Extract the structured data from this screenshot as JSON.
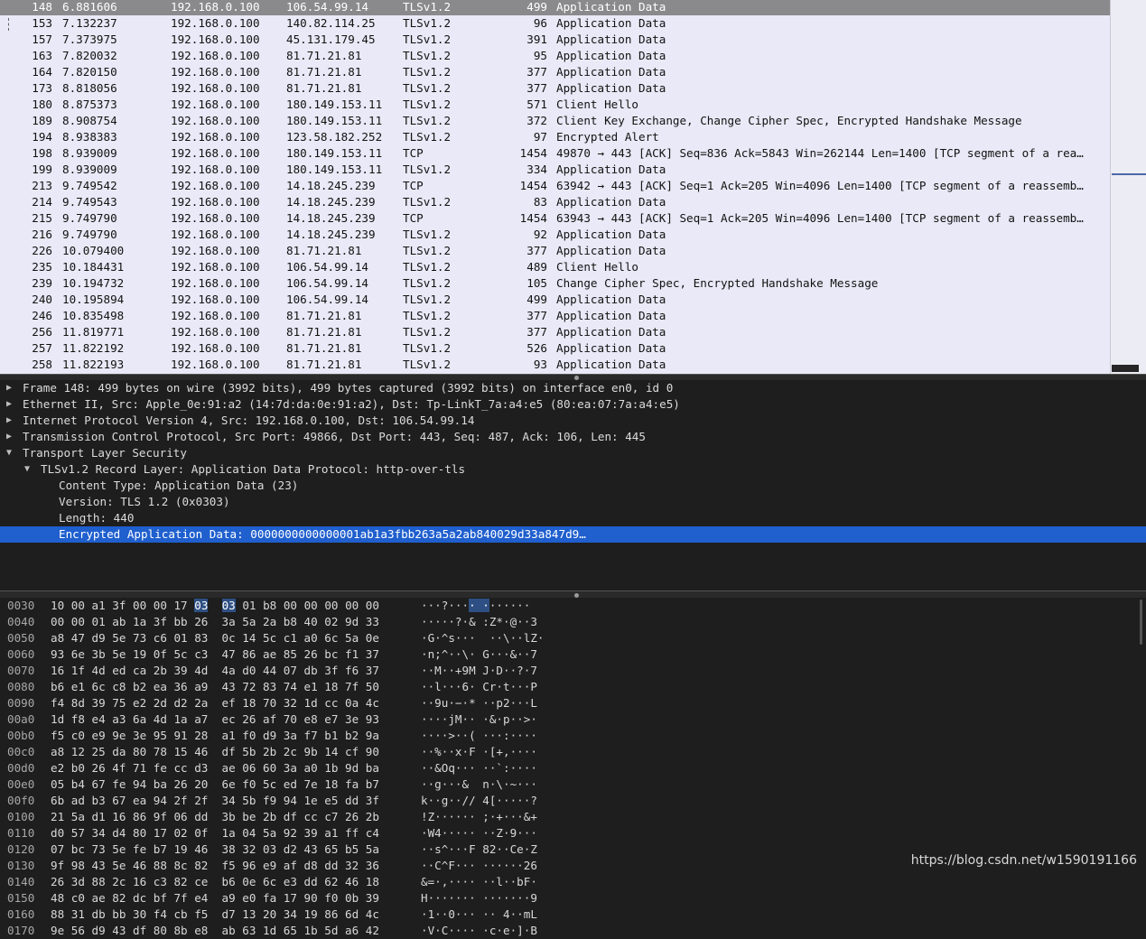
{
  "packet_list": {
    "rows": [
      {
        "no": "148",
        "time": "6.881606",
        "src": "192.168.0.100",
        "dst": "106.54.99.14",
        "proto": "TLSv1.2",
        "len": "499",
        "info": "Application Data",
        "selected": true
      },
      {
        "no": "153",
        "time": "7.132237",
        "src": "192.168.0.100",
        "dst": "140.82.114.25",
        "proto": "TLSv1.2",
        "len": "96",
        "info": "Application Data"
      },
      {
        "no": "157",
        "time": "7.373975",
        "src": "192.168.0.100",
        "dst": "45.131.179.45",
        "proto": "TLSv1.2",
        "len": "391",
        "info": "Application Data"
      },
      {
        "no": "163",
        "time": "7.820032",
        "src": "192.168.0.100",
        "dst": "81.71.21.81",
        "proto": "TLSv1.2",
        "len": "95",
        "info": "Application Data"
      },
      {
        "no": "164",
        "time": "7.820150",
        "src": "192.168.0.100",
        "dst": "81.71.21.81",
        "proto": "TLSv1.2",
        "len": "377",
        "info": "Application Data"
      },
      {
        "no": "173",
        "time": "8.818056",
        "src": "192.168.0.100",
        "dst": "81.71.21.81",
        "proto": "TLSv1.2",
        "len": "377",
        "info": "Application Data"
      },
      {
        "no": "180",
        "time": "8.875373",
        "src": "192.168.0.100",
        "dst": "180.149.153.11",
        "proto": "TLSv1.2",
        "len": "571",
        "info": "Client Hello"
      },
      {
        "no": "189",
        "time": "8.908754",
        "src": "192.168.0.100",
        "dst": "180.149.153.11",
        "proto": "TLSv1.2",
        "len": "372",
        "info": "Client Key Exchange, Change Cipher Spec, Encrypted Handshake Message"
      },
      {
        "no": "194",
        "time": "8.938383",
        "src": "192.168.0.100",
        "dst": "123.58.182.252",
        "proto": "TLSv1.2",
        "len": "97",
        "info": "Encrypted Alert"
      },
      {
        "no": "198",
        "time": "8.939009",
        "src": "192.168.0.100",
        "dst": "180.149.153.11",
        "proto": "TCP",
        "len": "1454",
        "info": "49870 → 443 [ACK] Seq=836 Ack=5843 Win=262144 Len=1400 [TCP segment of a rea…"
      },
      {
        "no": "199",
        "time": "8.939009",
        "src": "192.168.0.100",
        "dst": "180.149.153.11",
        "proto": "TLSv1.2",
        "len": "334",
        "info": "Application Data"
      },
      {
        "no": "213",
        "time": "9.749542",
        "src": "192.168.0.100",
        "dst": "14.18.245.239",
        "proto": "TCP",
        "len": "1454",
        "info": "63942 → 443 [ACK] Seq=1 Ack=205 Win=4096 Len=1400 [TCP segment of a reassemb…"
      },
      {
        "no": "214",
        "time": "9.749543",
        "src": "192.168.0.100",
        "dst": "14.18.245.239",
        "proto": "TLSv1.2",
        "len": "83",
        "info": "Application Data"
      },
      {
        "no": "215",
        "time": "9.749790",
        "src": "192.168.0.100",
        "dst": "14.18.245.239",
        "proto": "TCP",
        "len": "1454",
        "info": "63943 → 443 [ACK] Seq=1 Ack=205 Win=4096 Len=1400 [TCP segment of a reassemb…"
      },
      {
        "no": "216",
        "time": "9.749790",
        "src": "192.168.0.100",
        "dst": "14.18.245.239",
        "proto": "TLSv1.2",
        "len": "92",
        "info": "Application Data"
      },
      {
        "no": "226",
        "time": "10.079400",
        "src": "192.168.0.100",
        "dst": "81.71.21.81",
        "proto": "TLSv1.2",
        "len": "377",
        "info": "Application Data"
      },
      {
        "no": "235",
        "time": "10.184431",
        "src": "192.168.0.100",
        "dst": "106.54.99.14",
        "proto": "TLSv1.2",
        "len": "489",
        "info": "Client Hello"
      },
      {
        "no": "239",
        "time": "10.194732",
        "src": "192.168.0.100",
        "dst": "106.54.99.14",
        "proto": "TLSv1.2",
        "len": "105",
        "info": "Change Cipher Spec, Encrypted Handshake Message"
      },
      {
        "no": "240",
        "time": "10.195894",
        "src": "192.168.0.100",
        "dst": "106.54.99.14",
        "proto": "TLSv1.2",
        "len": "499",
        "info": "Application Data"
      },
      {
        "no": "246",
        "time": "10.835498",
        "src": "192.168.0.100",
        "dst": "81.71.21.81",
        "proto": "TLSv1.2",
        "len": "377",
        "info": "Application Data"
      },
      {
        "no": "256",
        "time": "11.819771",
        "src": "192.168.0.100",
        "dst": "81.71.21.81",
        "proto": "TLSv1.2",
        "len": "377",
        "info": "Application Data"
      },
      {
        "no": "257",
        "time": "11.822192",
        "src": "192.168.0.100",
        "dst": "81.71.21.81",
        "proto": "TLSv1.2",
        "len": "526",
        "info": "Application Data"
      },
      {
        "no": "258",
        "time": "11.822193",
        "src": "192.168.0.100",
        "dst": "81.71.21.81",
        "proto": "TLSv1.2",
        "len": "93",
        "info": "Application Data"
      }
    ]
  },
  "details": {
    "rows": [
      {
        "level": 0,
        "arrow": "collapsed",
        "text": "Frame 148: 499 bytes on wire (3992 bits), 499 bytes captured (3992 bits) on interface en0, id 0"
      },
      {
        "level": 0,
        "arrow": "collapsed",
        "text": "Ethernet II, Src: Apple_0e:91:a2 (14:7d:da:0e:91:a2), Dst: Tp-LinkT_7a:a4:e5 (80:ea:07:7a:a4:e5)"
      },
      {
        "level": 0,
        "arrow": "collapsed",
        "text": "Internet Protocol Version 4, Src: 192.168.0.100, Dst: 106.54.99.14"
      },
      {
        "level": 0,
        "arrow": "collapsed",
        "text": "Transmission Control Protocol, Src Port: 49866, Dst Port: 443, Seq: 487, Ack: 106, Len: 445"
      },
      {
        "level": 0,
        "arrow": "expanded",
        "text": "Transport Layer Security"
      },
      {
        "level": 1,
        "arrow": "expanded",
        "text": "TLSv1.2 Record Layer: Application Data Protocol: http-over-tls"
      },
      {
        "level": 2,
        "arrow": "none",
        "text": "Content Type: Application Data (23)"
      },
      {
        "level": 2,
        "arrow": "none",
        "text": "Version: TLS 1.2 (0x0303)"
      },
      {
        "level": 2,
        "arrow": "none",
        "text": "Length: 440"
      },
      {
        "level": 2,
        "arrow": "none",
        "text": "Encrypted Application Data: 0000000000000001ab1a3fbb263a5a2ab840029d33a847d9…",
        "selected": true
      }
    ]
  },
  "hex": {
    "rows": [
      {
        "offset": "0030",
        "b1": "10 00 a1 3f 00 00 17 ",
        "hl1": "03",
        "mid1": "  ",
        "hl2": "03",
        "rest": " 01 b8 00 00 00 00 00",
        "a1": "···?···",
        "ahl": "· ·",
        "a2": "······"
      },
      {
        "offset": "0040",
        "bytes": "00 00 01 ab 1a 3f bb 26  3a 5a 2a b8 40 02 9d 33",
        "ascii": "·····?·& :Z*·@··3"
      },
      {
        "offset": "0050",
        "bytes": "a8 47 d9 5e 73 c6 01 83  0c 14 5c c1 a0 6c 5a 0e",
        "ascii": "·G·^s···  ··\\··lZ·"
      },
      {
        "offset": "0060",
        "bytes": "93 6e 3b 5e 19 0f 5c c3  47 86 ae 85 26 bc f1 37",
        "ascii": "·n;^··\\· G···&··7"
      },
      {
        "offset": "0070",
        "bytes": "16 1f 4d ed ca 2b 39 4d  4a d0 44 07 db 3f f6 37",
        "ascii": "··M··+9M J·D··?·7"
      },
      {
        "offset": "0080",
        "bytes": "b6 e1 6c c8 b2 ea 36 a9  43 72 83 74 e1 18 7f 50",
        "ascii": "··l···6· Cr·t···P"
      },
      {
        "offset": "0090",
        "bytes": "f4 8d 39 75 e2 2d d2 2a  ef 18 70 32 1d cc 0a 4c",
        "ascii": "··9u·−·* ··p2···L"
      },
      {
        "offset": "00a0",
        "bytes": "1d f8 e4 a3 6a 4d 1a a7  ec 26 af 70 e8 e7 3e 93",
        "ascii": "····jM·· ·&·p··>·"
      },
      {
        "offset": "00b0",
        "bytes": "f5 c0 e9 9e 3e 95 91 28  a1 f0 d9 3a f7 b1 b2 9a",
        "ascii": "····>··( ···:····"
      },
      {
        "offset": "00c0",
        "bytes": "a8 12 25 da 80 78 15 46  df 5b 2b 2c 9b 14 cf 90",
        "ascii": "··%··x·F ·[+,····"
      },
      {
        "offset": "00d0",
        "bytes": "e2 b0 26 4f 71 fe cc d3  ae 06 60 3a a0 1b 9d ba",
        "ascii": "··&Oq··· ··`:····"
      },
      {
        "offset": "00e0",
        "bytes": "05 b4 67 fe 94 ba 26 20  6e f0 5c ed 7e 18 fa b7",
        "ascii": "··g···&  n·\\·~···"
      },
      {
        "offset": "00f0",
        "bytes": "6b ad b3 67 ea 94 2f 2f  34 5b f9 94 1e e5 dd 3f",
        "ascii": "k··g··// 4[·····?"
      },
      {
        "offset": "0100",
        "bytes": "21 5a d1 16 86 9f 06 dd  3b be 2b df cc c7 26 2b",
        "ascii": "!Z······ ;·+···&+"
      },
      {
        "offset": "0110",
        "bytes": "d0 57 34 d4 80 17 02 0f  1a 04 5a 92 39 a1 ff c4",
        "ascii": "·W4····· ··Z·9···"
      },
      {
        "offset": "0120",
        "bytes": "07 bc 73 5e fe b7 19 46  38 32 03 d2 43 65 b5 5a",
        "ascii": "··s^···F 82··Ce·Z"
      },
      {
        "offset": "0130",
        "bytes": "9f 98 43 5e 46 88 8c 82  f5 96 e9 af d8 dd 32 36",
        "ascii": "··C^F··· ······26"
      },
      {
        "offset": "0140",
        "bytes": "26 3d 88 2c 16 c3 82 ce  b6 0e 6c e3 dd 62 46 18",
        "ascii": "&=·,···· ··l··bF·"
      },
      {
        "offset": "0150",
        "bytes": "48 c0 ae 82 dc bf 7f e4  a9 e0 fa 17 90 f0 0b 39",
        "ascii": "H······· ·······9"
      },
      {
        "offset": "0160",
        "bytes": "88 31 db bb 30 f4 cb f5  d7 13 20 34 19 86 6d 4c",
        "ascii": "·1··0··· ·· 4··mL"
      },
      {
        "offset": "0170",
        "bytes": "9e 56 d9 43 df 80 8b e8  ab 63 1d 65 1b 5d a6 42",
        "ascii": "·V·C···· ·c·e·]·B"
      }
    ]
  },
  "watermark": "https://blog.csdn.net/w1590191166"
}
